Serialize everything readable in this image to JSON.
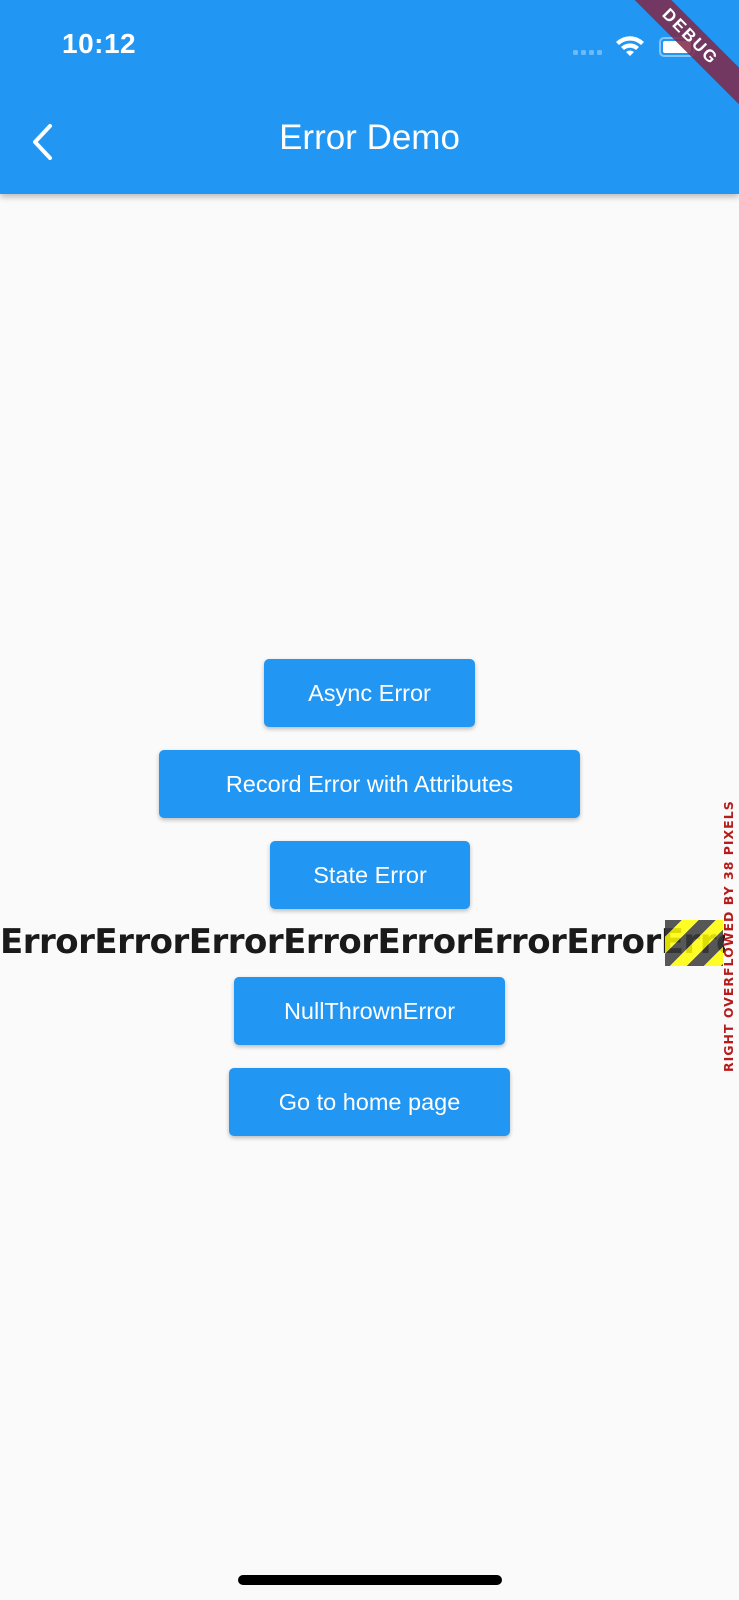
{
  "status_bar": {
    "time": "10:12",
    "signal_icon": "cellular-signal-icon",
    "wifi_icon": "wifi-icon",
    "battery_icon": "battery-icon"
  },
  "app_bar": {
    "title": "Error Demo",
    "back_icon": "chevron-left-icon",
    "background_color": "#2196f3"
  },
  "debug_banner": "DEBUG",
  "buttons": [
    {
      "label": "Async Error"
    },
    {
      "label": "Record Error with Attributes"
    },
    {
      "label": "State Error"
    },
    {
      "label": "NullThrownError"
    },
    {
      "label": "Go to home page"
    }
  ],
  "overflow": {
    "text": "ErrorErrorErrorErrorErrorErrorErrorErrorError",
    "warning": "RIGHT OVERFLOWED BY 38 PIXELS",
    "warning_color": "#b71c1c"
  },
  "colors": {
    "accent": "#2196f3",
    "background": "#fafafa"
  }
}
